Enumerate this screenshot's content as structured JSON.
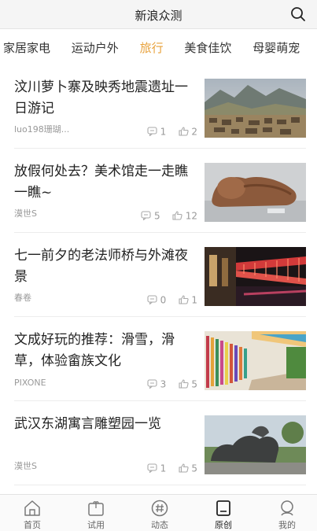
{
  "header": {
    "title": "新浪众测",
    "search_icon": "search-icon"
  },
  "categories": [
    {
      "label": "家居家电",
      "active": false
    },
    {
      "label": "运动户外",
      "active": false
    },
    {
      "label": "旅行",
      "active": true
    },
    {
      "label": "美食佳饮",
      "active": false
    },
    {
      "label": "母婴萌宠",
      "active": false
    }
  ],
  "accent_color": "#e8a13a",
  "articles": [
    {
      "title": "汶川萝卜寨及映秀地震遗址一日游记",
      "author": "luo198珊瑚...",
      "comments": "1",
      "likes": "2"
    },
    {
      "title": "放假何处去？美术馆走一走瞧一瞧~",
      "author": "漠世S",
      "comments": "5",
      "likes": "12"
    },
    {
      "title": "七一前夕的老法师桥与外滩夜景",
      "author": "春卷",
      "comments": "0",
      "likes": "1"
    },
    {
      "title": "文成好玩的推荐：滑雪，滑草，体验畲族文化",
      "author": "PIXONE",
      "comments": "3",
      "likes": "5"
    },
    {
      "title": "武汉东湖寓言雕塑园一览",
      "author": "漠世S",
      "comments": "1",
      "likes": "5"
    }
  ],
  "tabbar": [
    {
      "label": "首页",
      "icon": "home-icon",
      "active": false
    },
    {
      "label": "试用",
      "icon": "gift-icon",
      "active": false
    },
    {
      "label": "动态",
      "icon": "hashtag-icon",
      "active": false
    },
    {
      "label": "原创",
      "icon": "document-icon",
      "active": true
    },
    {
      "label": "我的",
      "icon": "profile-icon",
      "active": false
    }
  ]
}
